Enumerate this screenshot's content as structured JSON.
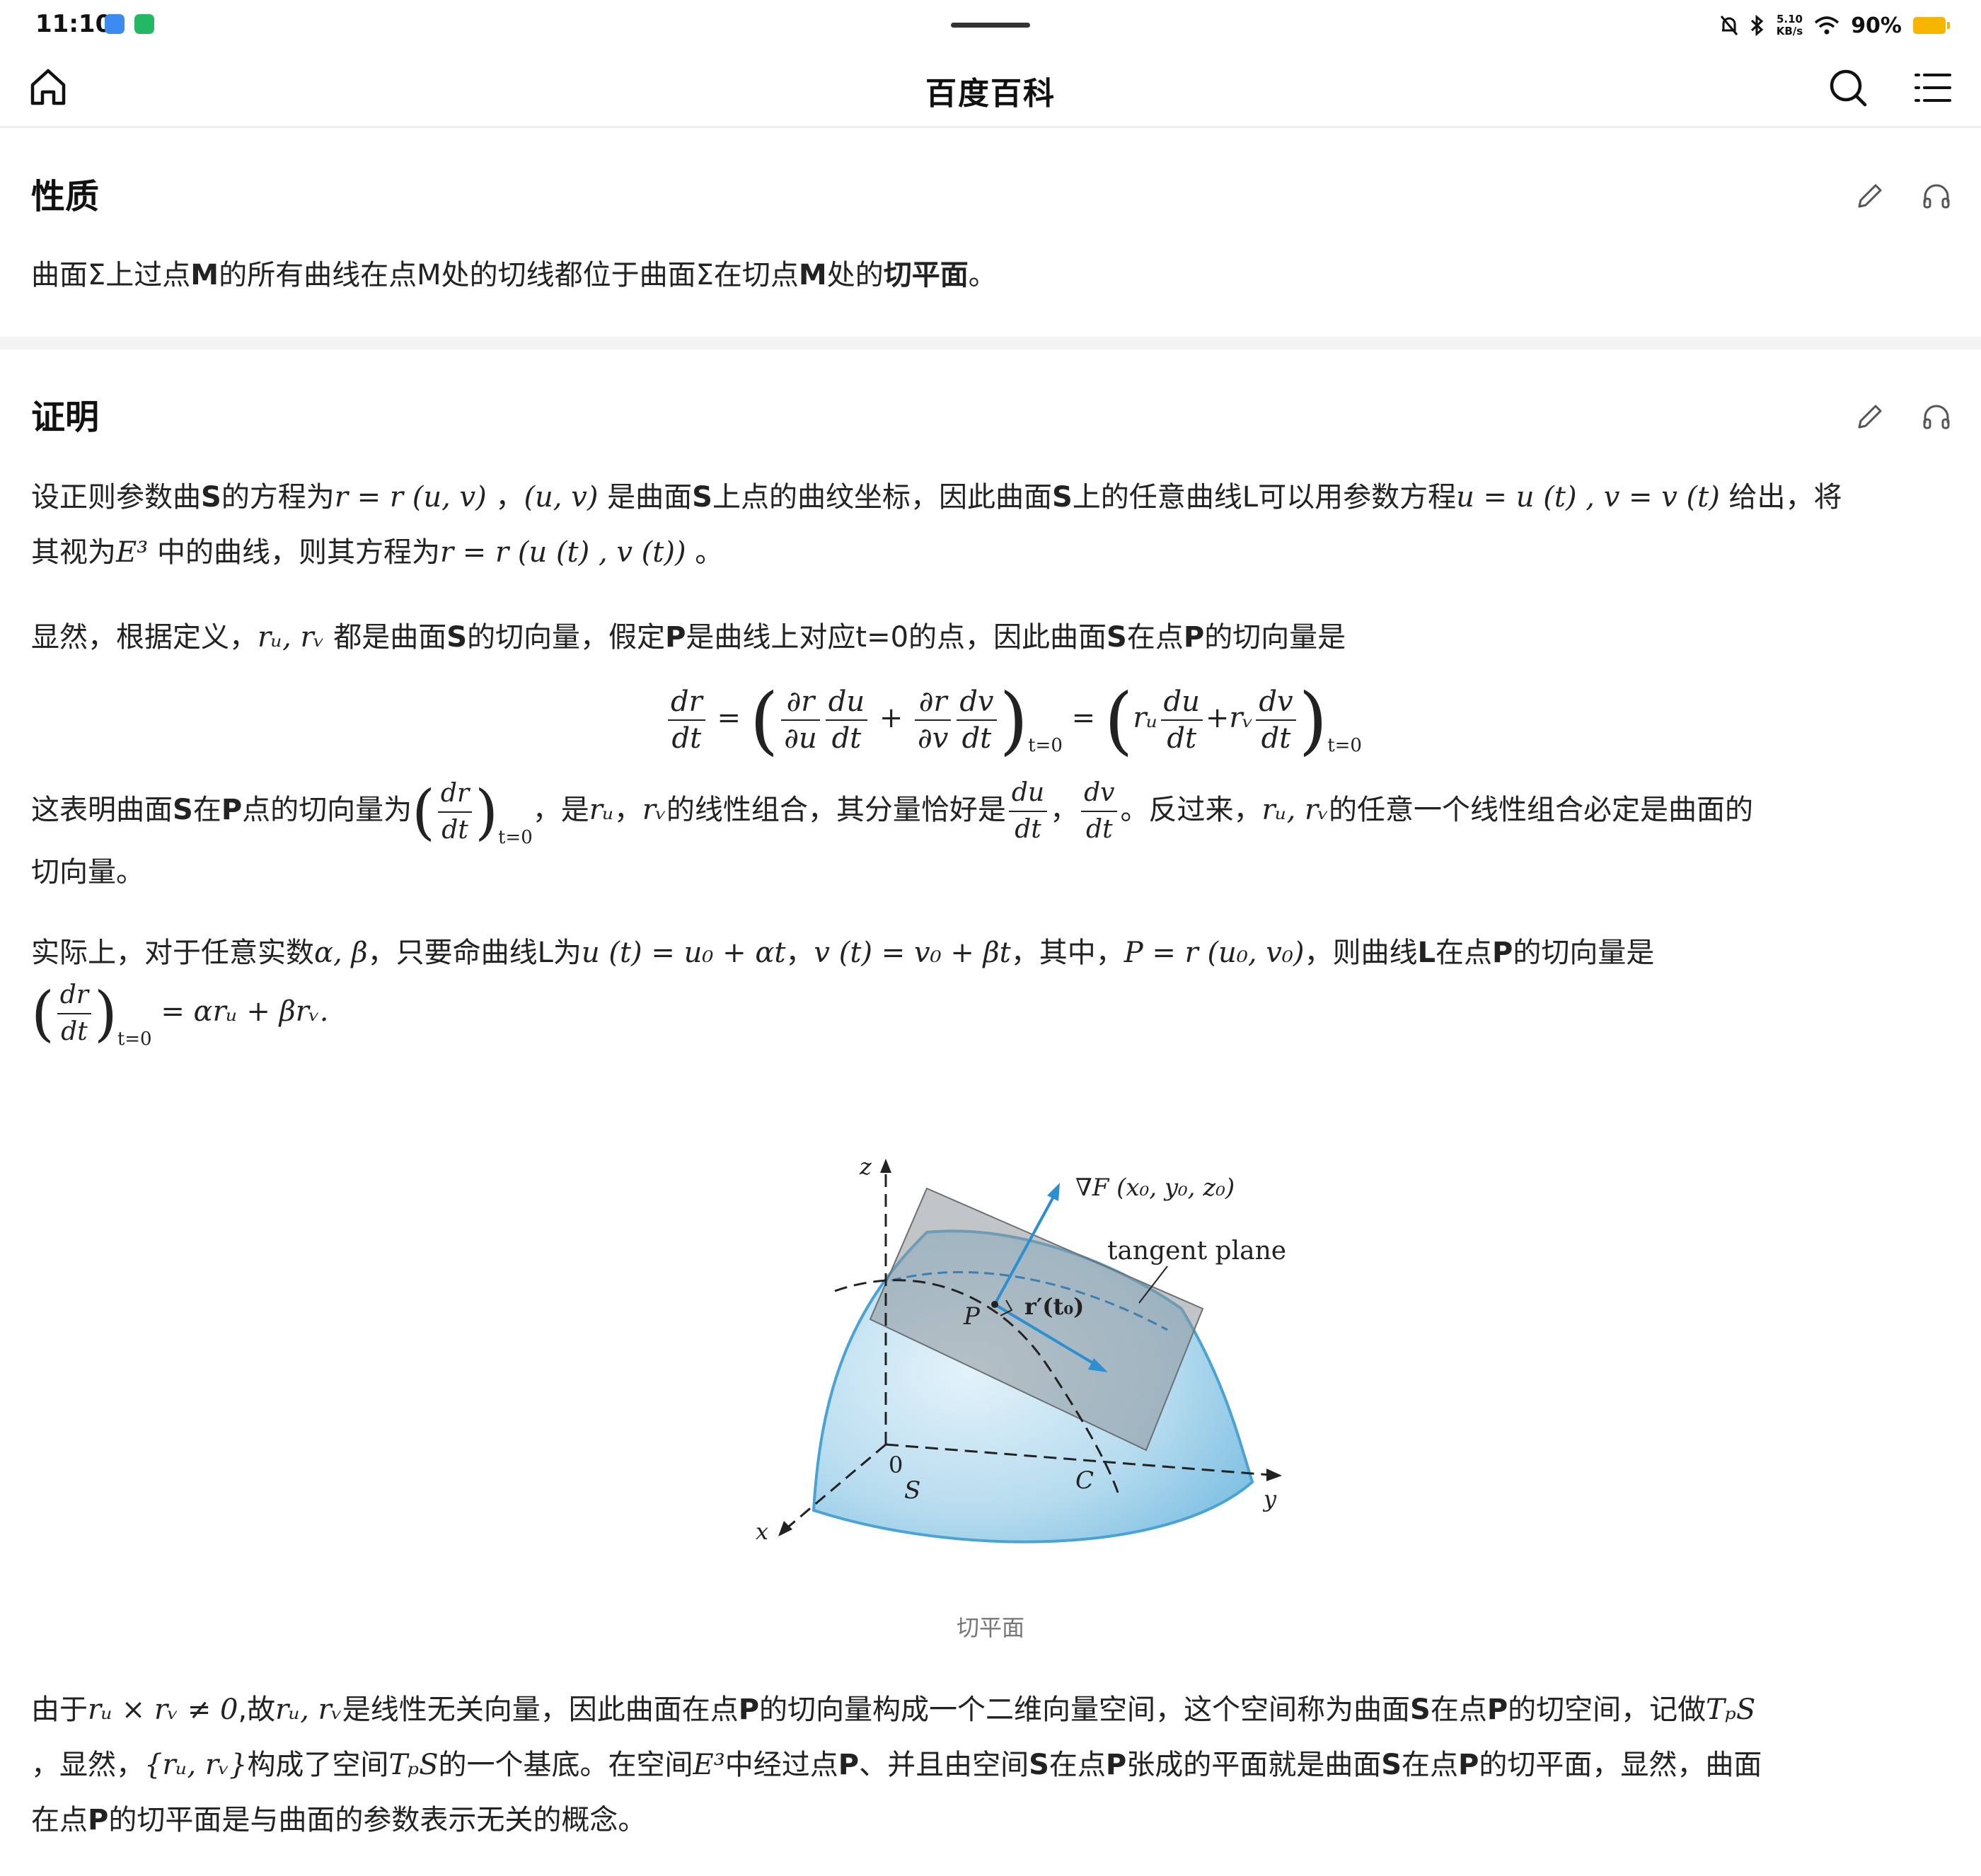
{
  "status": {
    "time": "11:10",
    "net_speed_value": "5.10",
    "net_speed_unit": "KB/s",
    "battery": "90%"
  },
  "nav": {
    "title": "百度百科"
  },
  "section1": {
    "title": "性质",
    "p1_a": "曲面Σ上过点",
    "p1_b": "M",
    "p1_c": "的所有曲线在点M处的切线都位于曲面Σ在切点",
    "p1_d": "M",
    "p1_e": "处的",
    "p1_f": "切平面",
    "p1_g": "。"
  },
  "section2": {
    "title": "证明",
    "l1_a": "设正则参数曲",
    "l1_b": "S",
    "l1_c": "的方程为",
    "l1_m1": "r = r (u, v)",
    "l1_d": " ，",
    "l1_m2": "(u, v)",
    "l1_e": " 是曲面",
    "l1_f": "S",
    "l1_g": "上点的曲纹坐标，因此曲面",
    "l1_h": "S",
    "l1_i": "上的任意曲线L可以用参数方程",
    "l1_m3": "u = u (t) , v = v (t)",
    "l1_j": " 给出，将",
    "l2_a": "其视为",
    "l2_m1": "E³",
    "l2_b": " 中的曲线，则其方程为",
    "l2_m2": "r = r (u (t) , v (t))",
    "l2_c": " 。",
    "l3_a": "显然，根据定义，",
    "l3_m1": "rᵤ, rᵥ",
    "l3_b": " 都是曲面",
    "l3_c": "S",
    "l3_d": "的切向量，假定",
    "l3_e": "P",
    "l3_f": "是曲线上对应t=0的点，因此曲面",
    "l3_g": "S",
    "l3_h": "在点",
    "l3_i": "P",
    "l3_j": "的切向量是",
    "f_dr": "dr",
    "f_dt": "dt",
    "f_eq": "=",
    "f_pr": "∂r",
    "f_pu": "∂u",
    "f_du": "du",
    "f_plus": "+",
    "f_pv": "∂v",
    "f_dv": "dv",
    "f_t0": "t=0",
    "f_ru": "rᵤ",
    "f_rv": "rᵥ",
    "l4_a": "这表明曲面",
    "l4_b": "S",
    "l4_c": "在",
    "l4_d": "P",
    "l4_e": "点的切向量为",
    "l4_f": "，是",
    "l4_m1": "rᵤ",
    "l4_g": "，",
    "l4_m2": "rᵥ",
    "l4_h": "的线性组合，其分量恰好是",
    "l4_i": "，",
    "l4_j": "。反过来，",
    "l4_m3": "rᵤ, rᵥ",
    "l4_k": "的任意一个线性组合必定是曲面的",
    "l5_a": "切向量。",
    "l6_a": "实际上，对于任意实数",
    "l6_m1": "α, β",
    "l6_b": "，只要命曲线L为",
    "l6_m2": "u (t) = u₀ + αt",
    "l6_c": "，",
    "l6_m3": "v (t) = v₀ + βt",
    "l6_d": "，其中，",
    "l6_m4": "P = r (u₀, v₀)",
    "l6_e": "，则曲线",
    "l6_f": "L",
    "l6_g": "在点",
    "l6_h": "P",
    "l6_i": "的切向量是",
    "l7_m1": "= αrᵤ + βrᵥ.",
    "l8_a": "由于",
    "l8_m1": "rᵤ × rᵥ ≠ 0",
    "l8_b": ",故",
    "l8_m2": "rᵤ, rᵥ",
    "l8_c": "是线性无关向量，因此曲面在点",
    "l8_d": "P",
    "l8_e": "的切向量构成一个二维向量空间，这个空间称为曲面",
    "l8_f": "S",
    "l8_g": "在点",
    "l8_h": "P",
    "l8_i": "的切空间，记做",
    "l8_m3": "TₚS",
    "l9_a": "，显然，",
    "l9_m1": "{rᵤ, rᵥ}",
    "l9_b": "构成了空间",
    "l9_m2": "TₚS",
    "l9_c": "的一个基底。在空间",
    "l9_m3": "E³",
    "l9_d": "中经过点",
    "l9_e": "P",
    "l9_f": "、并且由空间",
    "l9_g": "S",
    "l9_h": "在点",
    "l9_i": "P",
    "l9_j": "张成的平面就是曲面",
    "l9_k": "S",
    "l9_l": "在点",
    "l9_m": "P",
    "l9_n": "的切平面，显然，曲面",
    "l10_a": "在点",
    "l10_b": "P",
    "l10_c": "的切平面是与曲面的参数表示无关的概念。"
  },
  "figure": {
    "label_grad": "∇F (x₀, y₀, z₀)",
    "label_tangent": "tangent plane",
    "label_P": "P",
    "label_r": "r′(t₀)",
    "label_z": "z",
    "label_y": "y",
    "label_x": "x",
    "label_0": "0",
    "label_S": "S",
    "label_C": "C",
    "caption": "切平面"
  }
}
